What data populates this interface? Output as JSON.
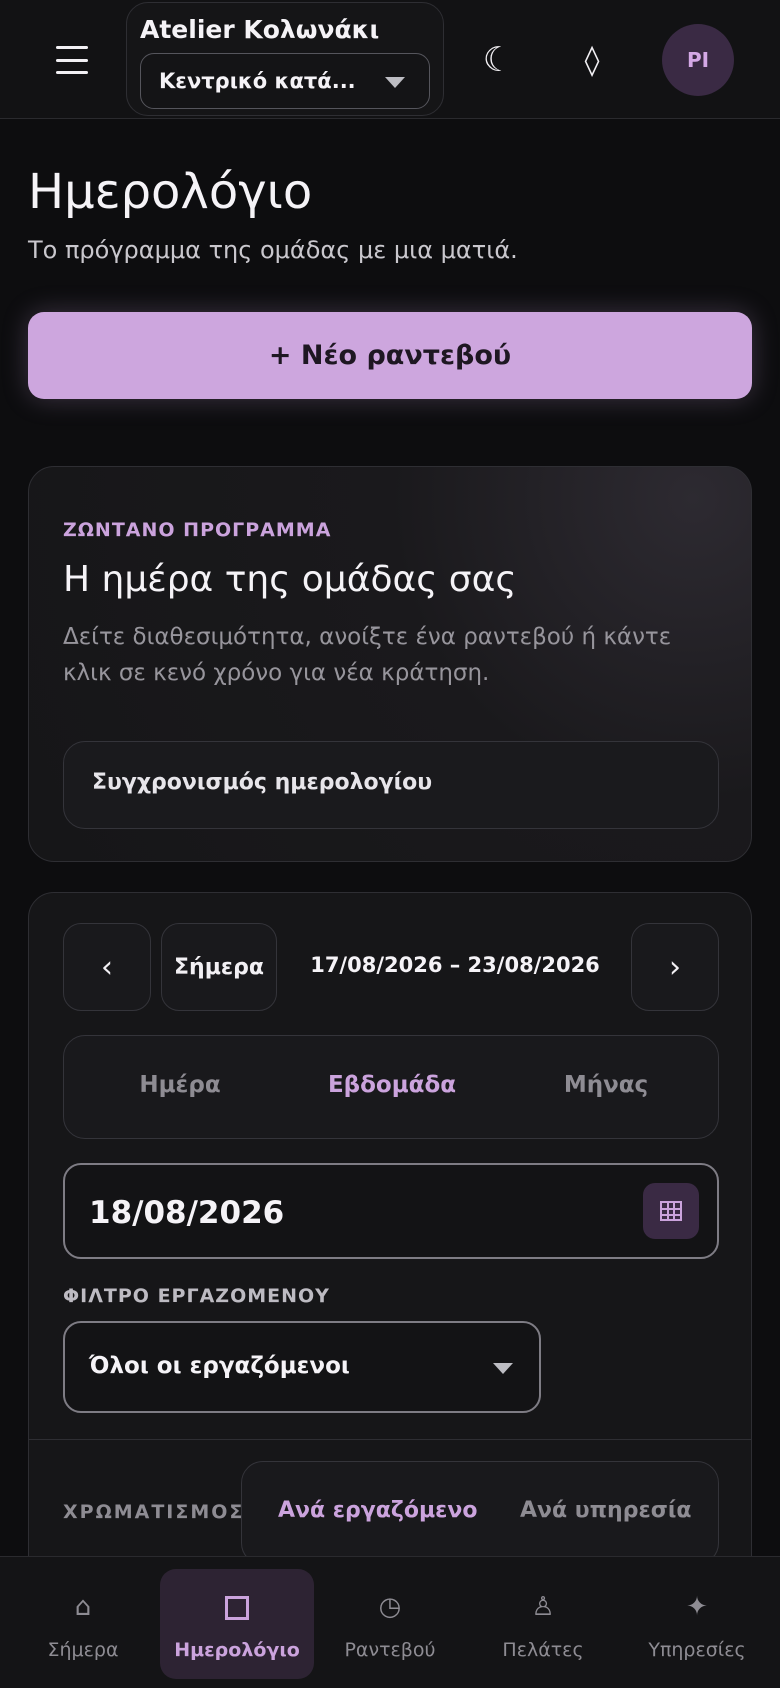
{
  "header": {
    "business_name": "Atelier Κολωνάκι",
    "location_select": "Κεντρικό κατά...",
    "menu_icon": "hamburger-icon",
    "theme_icon": "moon-icon",
    "theme_glyph": "☾",
    "accent_icon": "diamond-icon",
    "accent_glyph": "◊",
    "avatar_initials": "PI"
  },
  "page": {
    "title": "Ημερολόγιο",
    "subtitle": "Το πρόγραμμα της ομάδας με μια ματιά.",
    "new_button": "+ Νέο ραντεβού"
  },
  "live_card": {
    "eyebrow": "ΖΩΝΤΑΝΟ ΠΡΟΓΡΑΜΜΑ",
    "title": "Η ημέρα της ομάδας σας",
    "description": "Δείτε διαθεσιμότητα, ανοίξτε ένα ραντεβού ή κάντε κλικ σε κενό χρόνο για νέα κράτηση.",
    "sync_button": "Συγχρονισμός ημερολογίου"
  },
  "calendar": {
    "prev_glyph": "‹",
    "next_glyph": "›",
    "today_button": "Σήμερα",
    "range": "17/08/2026 – 23/08/2026",
    "views": [
      {
        "label": "Ημέρα",
        "active": false
      },
      {
        "label": "Εβδομάδα",
        "active": true
      },
      {
        "label": "Μήνας",
        "active": false
      }
    ],
    "date_value": "18/08/2026",
    "date_icon": "calendar-icon",
    "filter_label": "ΦΙΛΤΡΟ ΕΡΓΑΖΟΜΕΝΟΥ",
    "employee_select": "Όλοι οι εργαζόμενοι",
    "coloring_label": "ΧΡΩΜΑΤΙΣΜΟΣ",
    "coloring_options": [
      {
        "label": "Ανά εργαζόμενο",
        "active": true
      },
      {
        "label": "Ανά υπηρεσία",
        "active": false
      }
    ]
  },
  "bottom_nav": [
    {
      "label": "Σήμερα",
      "icon": "home-icon",
      "glyph": "⌂",
      "active": false
    },
    {
      "label": "Ημερολόγιο",
      "icon": "square-icon",
      "glyph": "",
      "active": true
    },
    {
      "label": "Ραντεβού",
      "icon": "clock-icon",
      "glyph": "◷",
      "active": false
    },
    {
      "label": "Πελάτες",
      "icon": "chess-pawn-icon",
      "glyph": "♙",
      "active": false
    },
    {
      "label": "Υπηρεσίες",
      "icon": "sparkle-icon",
      "glyph": "✦",
      "active": false
    }
  ],
  "colors": {
    "accent": "#cba3dd",
    "primary_button": "#cda6de",
    "background": "#0d0d0f",
    "card": "#161618"
  }
}
